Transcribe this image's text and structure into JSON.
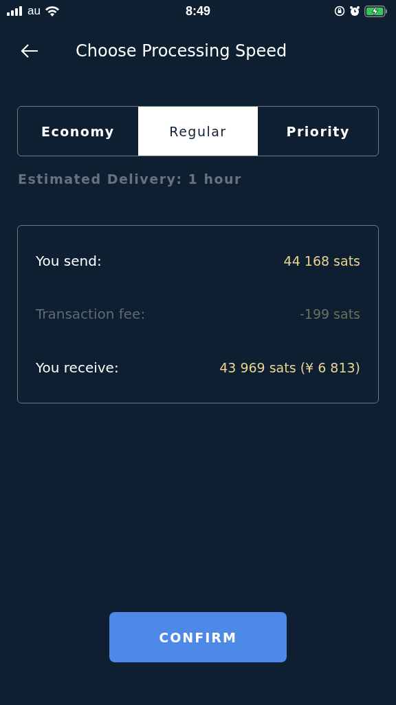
{
  "status_bar": {
    "carrier": "au",
    "time": "8:49"
  },
  "header": {
    "title": "Choose Processing Speed"
  },
  "tabs": [
    {
      "label": "Economy",
      "selected": false
    },
    {
      "label": "Regular",
      "selected": true
    },
    {
      "label": "Priority",
      "selected": false
    }
  ],
  "estimate": "Estimated Delivery: 1 hour",
  "summary": [
    {
      "label": "You send:",
      "value": "44 168 sats",
      "muted": false
    },
    {
      "label": "Transaction fee:",
      "value": "-199 sats",
      "muted": true
    },
    {
      "label": "You receive:",
      "value": "43 969 sats (¥ 6 813)",
      "muted": false
    }
  ],
  "confirm_button": "CONFIRM"
}
